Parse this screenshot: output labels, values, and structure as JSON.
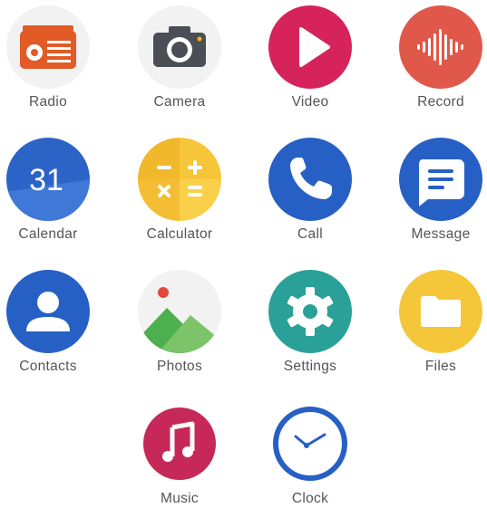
{
  "apps": [
    {
      "label": "Radio",
      "icon": "radio-icon",
      "color": "#e25b26"
    },
    {
      "label": "Camera",
      "icon": "camera-icon",
      "color": "#4a4f55"
    },
    {
      "label": "Video",
      "icon": "video-play-icon",
      "color": "#d6235c"
    },
    {
      "label": "Record",
      "icon": "record-waveform-icon",
      "color": "#e0584a"
    },
    {
      "label": "Calendar",
      "icon": "calendar-icon",
      "color": "#2b63c7",
      "date": "31"
    },
    {
      "label": "Calculator",
      "icon": "calculator-icon",
      "color": "#f2b82c"
    },
    {
      "label": "Call",
      "icon": "phone-icon",
      "color": "#2760c4"
    },
    {
      "label": "Message",
      "icon": "message-icon",
      "color": "#2760c4"
    },
    {
      "label": "Contacts",
      "icon": "contact-person-icon",
      "color": "#2760c4"
    },
    {
      "label": "Photos",
      "icon": "photos-landscape-icon",
      "color": "#4caf50"
    },
    {
      "label": "Settings",
      "icon": "settings-gear-icon",
      "color": "#2aa198"
    },
    {
      "label": "Files",
      "icon": "folder-icon",
      "color": "#f6c63a"
    },
    {
      "label": "Music",
      "icon": "music-note-icon",
      "color": "#c7285a"
    },
    {
      "label": "Clock",
      "icon": "clock-icon",
      "color": "#2760c4"
    }
  ]
}
